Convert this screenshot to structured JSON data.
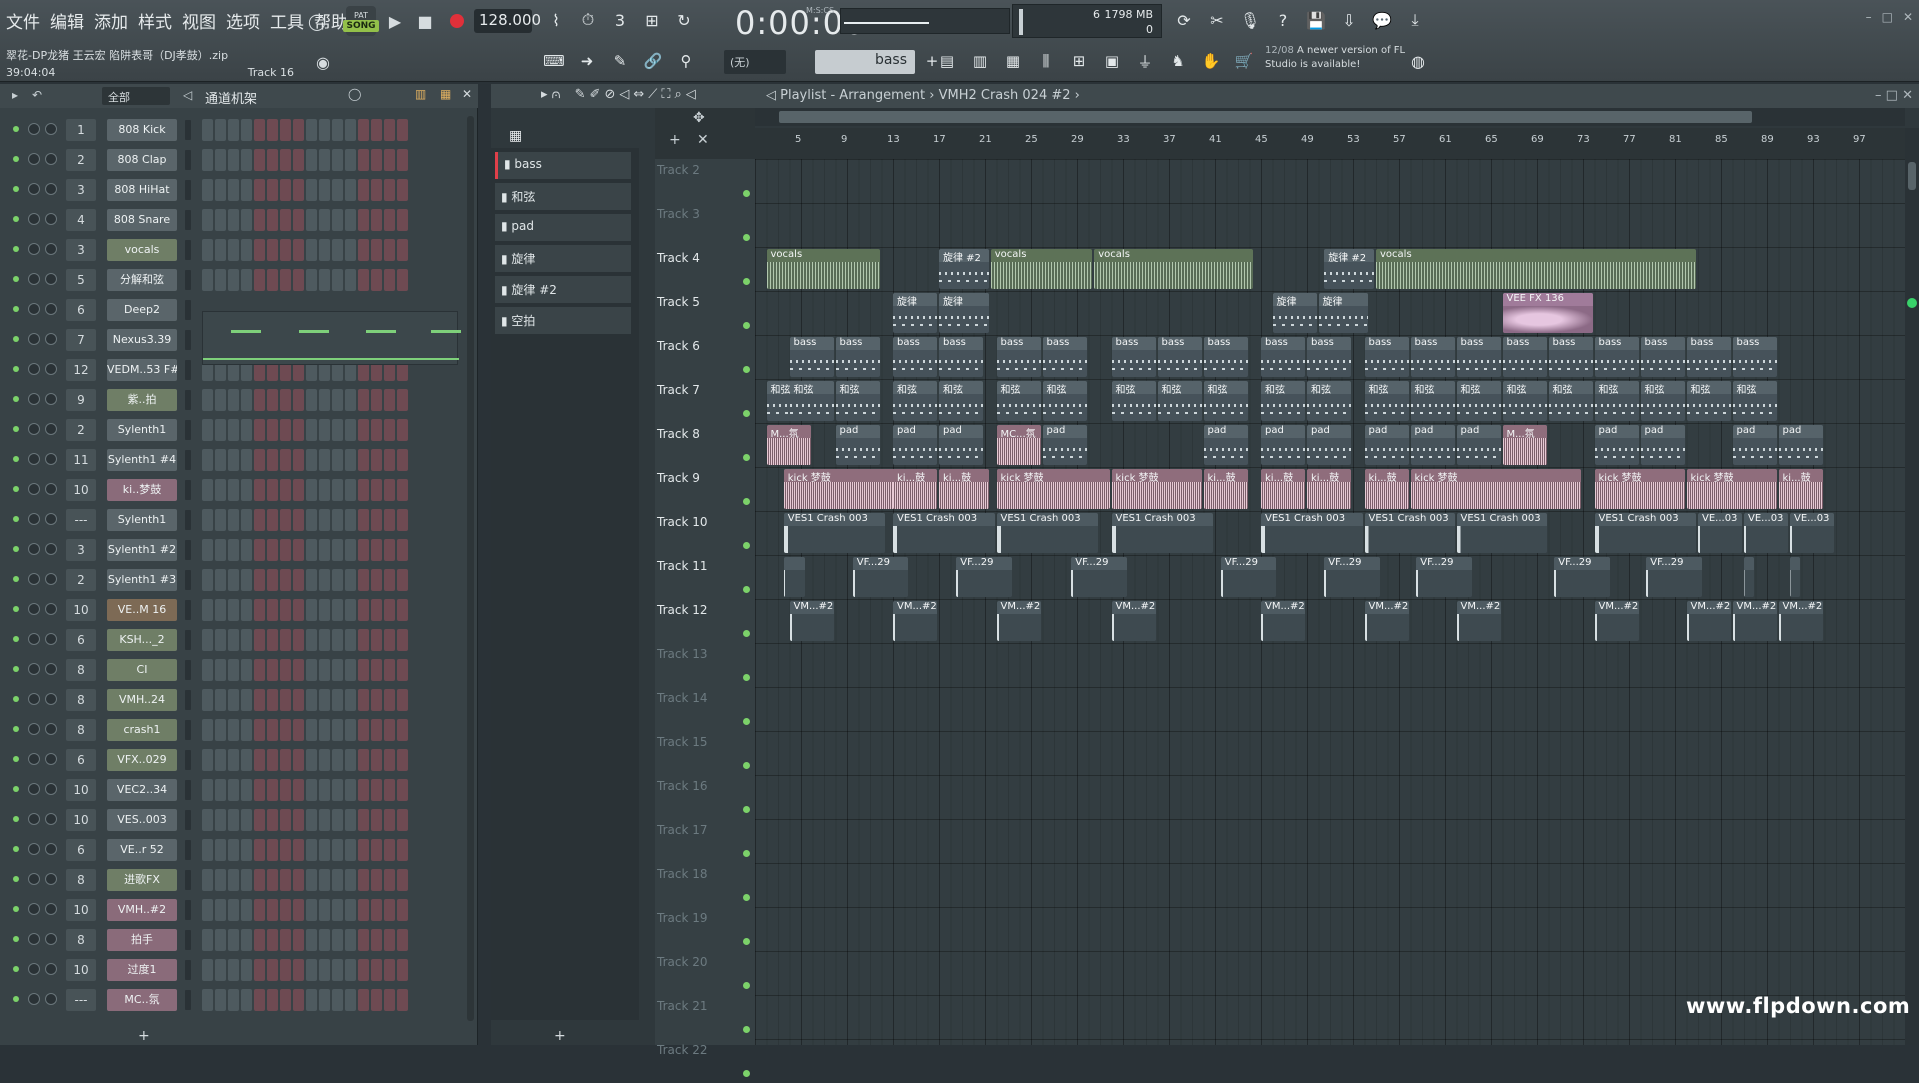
{
  "menu": [
    "文件",
    "编辑",
    "添加",
    "样式",
    "视图",
    "选项",
    "工具",
    "帮助"
  ],
  "file": {
    "name": "翠花-DP龙猪 王云宏 陷阱表哥（DJ孝鼓）.zip",
    "time": "39:04:04",
    "track_hint": "Track 16"
  },
  "transport": {
    "mode_label": "SONG",
    "mode_tag": "PAT",
    "tempo": "128.000",
    "time": "0:00:00",
    "time_unit": "M:S:CS",
    "pattern_label": "bass",
    "snap": "(无)"
  },
  "cpu": {
    "memory": "1798 MB",
    "polyphony": "0",
    "cpu_value": "6"
  },
  "notice": {
    "date": "12/08",
    "text": "A newer version of FL Studio is available!"
  },
  "channel_rack": {
    "group": "全部",
    "title": "通道机架",
    "channels": [
      {
        "mix": "1",
        "name": "808 Kick",
        "kind": "normal"
      },
      {
        "mix": "2",
        "name": "808 Clap",
        "kind": "normal"
      },
      {
        "mix": "3",
        "name": "808 HiHat",
        "kind": "normal"
      },
      {
        "mix": "4",
        "name": "808 Snare",
        "kind": "normal"
      },
      {
        "mix": "3",
        "name": "vocals",
        "kind": "audio"
      },
      {
        "mix": "5",
        "name": "分解和弦",
        "kind": "normal"
      },
      {
        "mix": "6",
        "name": "Deep2",
        "kind": "normal"
      },
      {
        "mix": "7",
        "name": "Nexus3.39",
        "kind": "normal"
      },
      {
        "mix": "12",
        "name": "VEDM..53 F#",
        "kind": "normal"
      },
      {
        "mix": "9",
        "name": "紫..拍",
        "kind": "audio"
      },
      {
        "mix": "2",
        "name": "Sylenth1",
        "kind": "normal"
      },
      {
        "mix": "11",
        "name": "Sylenth1 #4",
        "kind": "normal"
      },
      {
        "mix": "10",
        "name": "ki..梦鼓",
        "kind": "pink"
      },
      {
        "mix": "---",
        "name": "Sylenth1",
        "kind": "normal"
      },
      {
        "mix": "3",
        "name": "Sylenth1 #2",
        "kind": "normal"
      },
      {
        "mix": "2",
        "name": "Sylenth1 #3",
        "kind": "normal"
      },
      {
        "mix": "10",
        "name": "VE..M 16",
        "kind": "brown"
      },
      {
        "mix": "6",
        "name": "KSH..._2",
        "kind": "audio"
      },
      {
        "mix": "8",
        "name": "CI",
        "kind": "audio"
      },
      {
        "mix": "8",
        "name": "VMH..24",
        "kind": "audio"
      },
      {
        "mix": "8",
        "name": "crash1",
        "kind": "audio"
      },
      {
        "mix": "6",
        "name": "VFX..029",
        "kind": "audio"
      },
      {
        "mix": "10",
        "name": "VEC2..34",
        "kind": "normal"
      },
      {
        "mix": "10",
        "name": "VES..003",
        "kind": "normal"
      },
      {
        "mix": "6",
        "name": "VE..r 52",
        "kind": "normal"
      },
      {
        "mix": "8",
        "name": "进歌FX",
        "kind": "audio"
      },
      {
        "mix": "10",
        "name": "VMH..#2",
        "kind": "pink"
      },
      {
        "mix": "8",
        "name": "拍手",
        "kind": "pink"
      },
      {
        "mix": "10",
        "name": "过度1",
        "kind": "pink"
      },
      {
        "mix": "---",
        "name": "MC..氛",
        "kind": "pink"
      }
    ]
  },
  "patterns": [
    "bass",
    "和弦",
    "pad",
    "旋律",
    "旋律 #2",
    "空拍"
  ],
  "playlist": {
    "title": "Playlist - Arrangement",
    "breadcrumb": "VMH2 Crash 024 #2",
    "ticks": [
      "5",
      "9",
      "13",
      "17",
      "21",
      "25",
      "29",
      "33",
      "37",
      "41",
      "45",
      "49",
      "53",
      "57",
      "61",
      "65",
      "69",
      "73",
      "77",
      "81",
      "85",
      "89",
      "93",
      "97"
    ],
    "tracks": [
      "Track 2",
      "Track 3",
      "Track 4",
      "Track 5",
      "Track 6",
      "Track 7",
      "Track 8",
      "Track 9",
      "Track 10",
      "Track 11",
      "Track 12",
      "Track 13",
      "Track 14",
      "Track 15",
      "Track 16",
      "Track 17",
      "Track 18",
      "Track 19",
      "Track 20",
      "Track 21",
      "Track 22"
    ],
    "clips": [
      {
        "track": 2,
        "start": 1,
        "len": 10,
        "label": "vocals",
        "kind": "audio"
      },
      {
        "track": 2,
        "start": 16,
        "len": 4.5,
        "label": "旋律 #2",
        "kind": "pat"
      },
      {
        "track": 2,
        "start": 20.5,
        "len": 9,
        "label": "vocals",
        "kind": "audio"
      },
      {
        "track": 2,
        "start": 29.5,
        "len": 14,
        "label": "vocals",
        "kind": "audio"
      },
      {
        "track": 2,
        "start": 49.5,
        "len": 4.5,
        "label": "旋律 #2",
        "kind": "pat"
      },
      {
        "track": 2,
        "start": 54,
        "len": 28,
        "label": "vocals",
        "kind": "audio"
      },
      {
        "track": 3,
        "start": 12,
        "len": 4,
        "label": "旋律",
        "kind": "pat"
      },
      {
        "track": 3,
        "start": 16,
        "len": 4.5,
        "label": "旋律",
        "kind": "pat"
      },
      {
        "track": 3,
        "start": 45,
        "len": 4,
        "label": "旋律",
        "kind": "pat"
      },
      {
        "track": 3,
        "start": 49,
        "len": 4.5,
        "label": "旋律",
        "kind": "pat"
      },
      {
        "track": 3,
        "start": 65,
        "len": 8,
        "label": "VEE FX 136",
        "kind": "vee"
      },
      {
        "track": 4,
        "start": 3,
        "len": 4,
        "label": "bass",
        "kind": "pat"
      },
      {
        "track": 4,
        "start": 7,
        "len": 4,
        "label": "bass",
        "kind": "pat"
      },
      {
        "track": 4,
        "start": 12,
        "len": 4,
        "label": "bass",
        "kind": "pat"
      },
      {
        "track": 4,
        "start": 16,
        "len": 4,
        "label": "bass",
        "kind": "pat"
      },
      {
        "track": 4,
        "start": 21,
        "len": 4,
        "label": "bass",
        "kind": "pat"
      },
      {
        "track": 4,
        "start": 25,
        "len": 4,
        "label": "bass",
        "kind": "pat"
      },
      {
        "track": 4,
        "start": 31,
        "len": 4,
        "label": "bass",
        "kind": "pat"
      },
      {
        "track": 4,
        "start": 35,
        "len": 4,
        "label": "bass",
        "kind": "pat"
      },
      {
        "track": 4,
        "start": 39,
        "len": 4,
        "label": "bass",
        "kind": "pat"
      },
      {
        "track": 4,
        "start": 44,
        "len": 4,
        "label": "bass",
        "kind": "pat"
      },
      {
        "track": 4,
        "start": 48,
        "len": 4,
        "label": "bass",
        "kind": "pat"
      },
      {
        "track": 4,
        "start": 53,
        "len": 4,
        "label": "bass",
        "kind": "pat"
      },
      {
        "track": 4,
        "start": 57,
        "len": 4,
        "label": "bass",
        "kind": "pat"
      },
      {
        "track": 4,
        "start": 61,
        "len": 4,
        "label": "bass",
        "kind": "pat"
      },
      {
        "track": 4,
        "start": 65,
        "len": 4,
        "label": "bass",
        "kind": "pat"
      },
      {
        "track": 4,
        "start": 69,
        "len": 4,
        "label": "bass",
        "kind": "pat"
      },
      {
        "track": 4,
        "start": 73,
        "len": 4,
        "label": "bass",
        "kind": "pat"
      },
      {
        "track": 4,
        "start": 77,
        "len": 4,
        "label": "bass",
        "kind": "pat"
      },
      {
        "track": 4,
        "start": 81,
        "len": 4,
        "label": "bass",
        "kind": "pat"
      },
      {
        "track": 4,
        "start": 85,
        "len": 4,
        "label": "bass",
        "kind": "pat"
      },
      {
        "track": 5,
        "start": 1,
        "len": 3,
        "label": "和弦",
        "kind": "pat"
      },
      {
        "track": 5,
        "start": 3,
        "len": 4,
        "label": "和弦",
        "kind": "pat"
      },
      {
        "track": 5,
        "start": 7,
        "len": 4,
        "label": "和弦",
        "kind": "pat"
      },
      {
        "track": 5,
        "start": 12,
        "len": 4,
        "label": "和弦",
        "kind": "pat"
      },
      {
        "track": 5,
        "start": 16,
        "len": 4,
        "label": "和弦",
        "kind": "pat"
      },
      {
        "track": 5,
        "start": 21,
        "len": 4,
        "label": "和弦",
        "kind": "pat"
      },
      {
        "track": 5,
        "start": 25,
        "len": 4,
        "label": "和弦",
        "kind": "pat"
      },
      {
        "track": 5,
        "start": 31,
        "len": 4,
        "label": "和弦",
        "kind": "pat"
      },
      {
        "track": 5,
        "start": 35,
        "len": 4,
        "label": "和弦",
        "kind": "pat"
      },
      {
        "track": 5,
        "start": 39,
        "len": 4,
        "label": "和弦",
        "kind": "pat"
      },
      {
        "track": 5,
        "start": 44,
        "len": 4,
        "label": "和弦",
        "kind": "pat"
      },
      {
        "track": 5,
        "start": 48,
        "len": 4,
        "label": "和弦",
        "kind": "pat"
      },
      {
        "track": 5,
        "start": 53,
        "len": 4,
        "label": "和弦",
        "kind": "pat"
      },
      {
        "track": 5,
        "start": 57,
        "len": 4,
        "label": "和弦",
        "kind": "pat"
      },
      {
        "track": 5,
        "start": 61,
        "len": 4,
        "label": "和弦",
        "kind": "pat"
      },
      {
        "track": 5,
        "start": 65,
        "len": 4,
        "label": "和弦",
        "kind": "pat"
      },
      {
        "track": 5,
        "start": 69,
        "len": 4,
        "label": "和弦",
        "kind": "pat"
      },
      {
        "track": 5,
        "start": 73,
        "len": 4,
        "label": "和弦",
        "kind": "pat"
      },
      {
        "track": 5,
        "start": 77,
        "len": 4,
        "label": "和弦",
        "kind": "pat"
      },
      {
        "track": 5,
        "start": 81,
        "len": 4,
        "label": "和弦",
        "kind": "pat"
      },
      {
        "track": 5,
        "start": 85,
        "len": 4,
        "label": "和弦",
        "kind": "pat"
      },
      {
        "track": 6,
        "start": 1,
        "len": 4,
        "label": "M...氛",
        "kind": "pink"
      },
      {
        "track": 6,
        "start": 7,
        "len": 4,
        "label": "pad",
        "kind": "pat"
      },
      {
        "track": 6,
        "start": 12,
        "len": 4,
        "label": "pad",
        "kind": "pat"
      },
      {
        "track": 6,
        "start": 16,
        "len": 4,
        "label": "pad",
        "kind": "pat"
      },
      {
        "track": 6,
        "start": 21,
        "len": 4,
        "label": "MC...氛",
        "kind": "pink"
      },
      {
        "track": 6,
        "start": 25,
        "len": 4,
        "label": "pad",
        "kind": "pat"
      },
      {
        "track": 6,
        "start": 39,
        "len": 4,
        "label": "pad",
        "kind": "pat"
      },
      {
        "track": 6,
        "start": 44,
        "len": 4,
        "label": "pad",
        "kind": "pat"
      },
      {
        "track": 6,
        "start": 48,
        "len": 4,
        "label": "pad",
        "kind": "pat"
      },
      {
        "track": 6,
        "start": 53,
        "len": 4,
        "label": "pad",
        "kind": "pat"
      },
      {
        "track": 6,
        "start": 57,
        "len": 4,
        "label": "pad",
        "kind": "pat"
      },
      {
        "track": 6,
        "start": 61,
        "len": 4,
        "label": "pad",
        "kind": "pat"
      },
      {
        "track": 6,
        "start": 65,
        "len": 4,
        "label": "M...氛",
        "kind": "pink"
      },
      {
        "track": 6,
        "start": 73,
        "len": 4,
        "label": "pad",
        "kind": "pat"
      },
      {
        "track": 6,
        "start": 77,
        "len": 4,
        "label": "pad",
        "kind": "pat"
      },
      {
        "track": 6,
        "start": 85,
        "len": 4,
        "label": "pad",
        "kind": "pat"
      },
      {
        "track": 6,
        "start": 89,
        "len": 4,
        "label": "pad",
        "kind": "pat"
      },
      {
        "track": 7,
        "start": 2.5,
        "len": 10,
        "label": "kick 梦鼓",
        "kind": "pink"
      },
      {
        "track": 7,
        "start": 12,
        "len": 4,
        "label": "ki...鼓",
        "kind": "pink"
      },
      {
        "track": 7,
        "start": 16,
        "len": 4.5,
        "label": "ki...鼓",
        "kind": "pink"
      },
      {
        "track": 7,
        "start": 21,
        "len": 10,
        "label": "kick 梦鼓",
        "kind": "pink"
      },
      {
        "track": 7,
        "start": 31,
        "len": 8,
        "label": "kick 梦鼓",
        "kind": "pink"
      },
      {
        "track": 7,
        "start": 39,
        "len": 4,
        "label": "ki...鼓",
        "kind": "pink"
      },
      {
        "track": 7,
        "start": 44,
        "len": 4,
        "label": "ki...鼓",
        "kind": "pink"
      },
      {
        "track": 7,
        "start": 48,
        "len": 4,
        "label": "ki...鼓",
        "kind": "pink"
      },
      {
        "track": 7,
        "start": 53,
        "len": 4,
        "label": "ki...鼓",
        "kind": "pink"
      },
      {
        "track": 7,
        "start": 57,
        "len": 15,
        "label": "kick 梦鼓",
        "kind": "pink"
      },
      {
        "track": 7,
        "start": 73,
        "len": 8,
        "label": "kick 梦鼓",
        "kind": "pink"
      },
      {
        "track": 7,
        "start": 81,
        "len": 8,
        "label": "kick 梦鼓",
        "kind": "pink"
      },
      {
        "track": 7,
        "start": 89,
        "len": 4,
        "label": "ki...鼓",
        "kind": "pink"
      },
      {
        "track": 8,
        "start": 2.5,
        "len": 9,
        "label": "VES1 Crash 003",
        "kind": "crash"
      },
      {
        "track": 8,
        "start": 12,
        "len": 9,
        "label": "VES1 Crash 003",
        "kind": "crash"
      },
      {
        "track": 8,
        "start": 21,
        "len": 9,
        "label": "VES1 Crash 003",
        "kind": "crash"
      },
      {
        "track": 8,
        "start": 31,
        "len": 9,
        "label": "VES1 Crash 003",
        "kind": "crash"
      },
      {
        "track": 8,
        "start": 44,
        "len": 9,
        "label": "VES1 Crash 003",
        "kind": "crash"
      },
      {
        "track": 8,
        "start": 53,
        "len": 8,
        "label": "VES1 Crash 003",
        "kind": "crash"
      },
      {
        "track": 8,
        "start": 61,
        "len": 8,
        "label": "VES1 Crash 003",
        "kind": "crash"
      },
      {
        "track": 8,
        "start": 73,
        "len": 9,
        "label": "VES1 Crash 003",
        "kind": "crash"
      },
      {
        "track": 8,
        "start": 82,
        "len": 4,
        "label": "VE...03",
        "kind": "crash"
      },
      {
        "track": 8,
        "start": 86,
        "len": 4,
        "label": "VE...03",
        "kind": "crash"
      },
      {
        "track": 8,
        "start": 90,
        "len": 4,
        "label": "VE...03",
        "kind": "crash"
      },
      {
        "track": 9,
        "start": 2.5,
        "len": 2,
        "label": "",
        "kind": "crash"
      },
      {
        "track": 9,
        "start": 8.5,
        "len": 5,
        "label": "VF...29",
        "kind": "crash"
      },
      {
        "track": 9,
        "start": 17.5,
        "len": 5,
        "label": "VF...29",
        "kind": "crash"
      },
      {
        "track": 9,
        "start": 27.5,
        "len": 5,
        "label": "VF...29",
        "kind": "crash"
      },
      {
        "track": 9,
        "start": 40.5,
        "len": 5,
        "label": "VF...29",
        "kind": "crash"
      },
      {
        "track": 9,
        "start": 49.5,
        "len": 5,
        "label": "VF...29",
        "kind": "crash"
      },
      {
        "track": 9,
        "start": 57.5,
        "len": 5,
        "label": "VF...29",
        "kind": "crash"
      },
      {
        "track": 9,
        "start": 69.5,
        "len": 5,
        "label": "VF...29",
        "kind": "crash"
      },
      {
        "track": 9,
        "start": 77.5,
        "len": 5,
        "label": "VF...29",
        "kind": "crash"
      },
      {
        "track": 9,
        "start": 86,
        "len": 1,
        "label": "",
        "kind": "crash"
      },
      {
        "track": 9,
        "start": 90,
        "len": 1,
        "label": "",
        "kind": "crash"
      },
      {
        "track": 10,
        "start": 3,
        "len": 4,
        "label": "VM...#2",
        "kind": "crash"
      },
      {
        "track": 10,
        "start": 12,
        "len": 4,
        "label": "VM...#2",
        "kind": "crash"
      },
      {
        "track": 10,
        "start": 21,
        "len": 4,
        "label": "VM...#2",
        "kind": "crash"
      },
      {
        "track": 10,
        "start": 31,
        "len": 4,
        "label": "VM...#2",
        "kind": "crash"
      },
      {
        "track": 10,
        "start": 44,
        "len": 4,
        "label": "VM...#2",
        "kind": "crash"
      },
      {
        "track": 10,
        "start": 53,
        "len": 4,
        "label": "VM...#2",
        "kind": "crash"
      },
      {
        "track": 10,
        "start": 61,
        "len": 4,
        "label": "VM...#2",
        "kind": "crash"
      },
      {
        "track": 10,
        "start": 73,
        "len": 4,
        "label": "VM...#2",
        "kind": "crash"
      },
      {
        "track": 10,
        "start": 81,
        "len": 4,
        "label": "VM...#2",
        "kind": "crash"
      },
      {
        "track": 10,
        "start": 85,
        "len": 4,
        "label": "VM...#2",
        "kind": "crash"
      },
      {
        "track": 10,
        "start": 89,
        "len": 4,
        "label": "VM...#2",
        "kind": "crash"
      }
    ]
  },
  "watermark": "www.flpdown.com",
  "window_controls": [
    "–",
    "□",
    "✕"
  ]
}
